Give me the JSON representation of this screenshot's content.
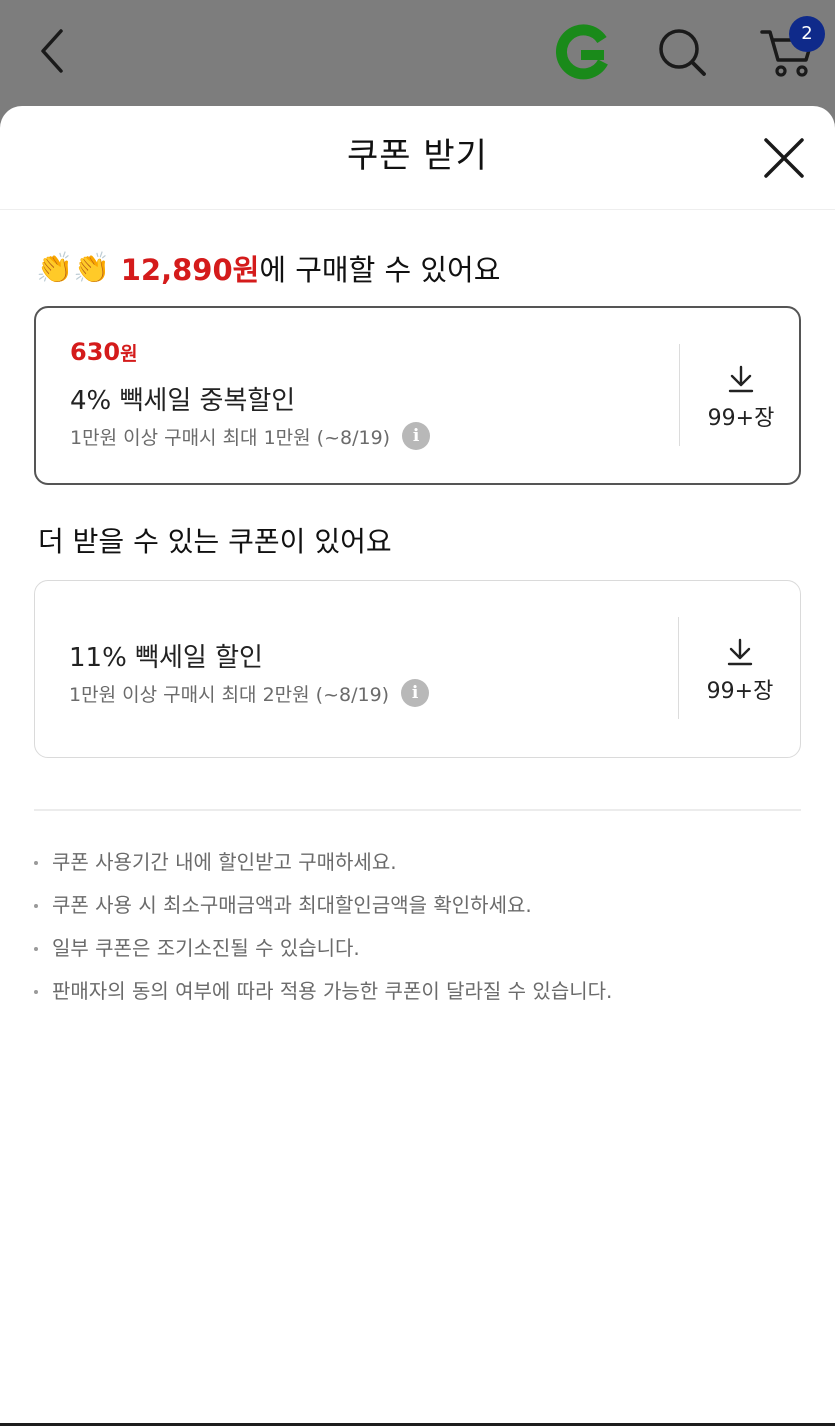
{
  "topbar": {
    "cart_badge": "2",
    "icons": [
      "back-chevron-icon",
      "g-logo-icon",
      "search-icon",
      "cart-icon"
    ],
    "logo_color": "#1a8a1a"
  },
  "sheet": {
    "title": "쿠폰 받기",
    "close_icon": "close-icon"
  },
  "headline": {
    "emoji": "👏👏",
    "price": "12,890원",
    "suffix": "에 구매할 수 있어요"
  },
  "applied_coupon": {
    "amount": "630",
    "amount_unit": "원",
    "name": "4% 빽세일 중복할인",
    "condition": "1만원 이상 구매시 최대 1만원 (~8/19)",
    "count": "99+장"
  },
  "more_heading": "더 받을 수 있는 쿠폰이 있어요",
  "more_coupon": {
    "name": "11% 빽세일 할인",
    "condition": "1만원 이상 구매시 최대 2만원 (~8/19)",
    "count": "99+장"
  },
  "notes": [
    "쿠폰 사용기간 내에 할인받고 구매하세요.",
    "쿠폰 사용 시 최소구매금액과 최대할인금액을 확인하세요.",
    "일부 쿠폰은 조기소진될 수 있습니다.",
    "판매자의 동의 여부에 따라 적용 가능한 쿠폰이 달라질 수 있습니다."
  ],
  "colors": {
    "accent_red": "#d41b1b",
    "badge_blue": "#0f2a8a",
    "overlay": "#7d7d7d"
  }
}
